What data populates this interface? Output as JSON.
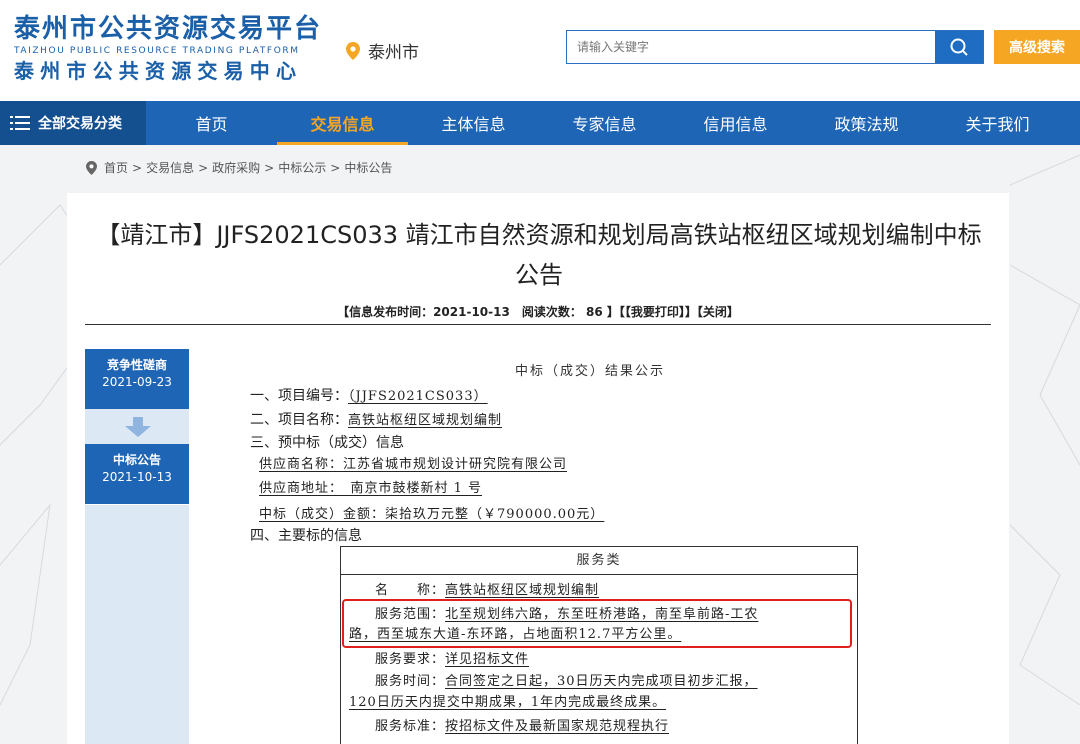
{
  "header": {
    "logo_title": "泰州市公共资源交易平台",
    "logo_en": "TAIZHOU PUBLIC RESOURCE TRADING PLATFORM",
    "logo_sub": "泰州市公共资源交易中心",
    "city": "泰州市",
    "search_placeholder": "请输入关键字",
    "advanced_search": "高级搜索"
  },
  "nav": {
    "all_categories": "全部交易分类",
    "items": [
      "首页",
      "交易信息",
      "主体信息",
      "专家信息",
      "信用信息",
      "政策法规",
      "关于我们"
    ],
    "active": "交易信息"
  },
  "breadcrumb": [
    "首页",
    "交易信息",
    "政府采购",
    "中标公示",
    "中标公告"
  ],
  "article": {
    "title": "【靖江市】JJFS2021CS033 靖江市自然资源和规划局高铁站枢纽区域规划编制中标公告",
    "meta": "【信息发布时间：2021-10-13　阅读次数： 86 】【【我要打印】】【关闭】"
  },
  "timeline": [
    {
      "name": "竞争性磋商",
      "date": "2021-09-23"
    },
    {
      "name": "中标公告",
      "date": "2021-10-13"
    }
  ],
  "document": {
    "heading": "中标（成交）结果公示",
    "s1_label": "一、项目编号：",
    "s1_value": "（JJFS2021CS033）",
    "s2_label": "二、项目名称：",
    "s2_value": "高铁站枢纽区域规划编制",
    "s3_label": "三、预中标（成交）信息",
    "supplier_name": "供应商名称：江苏省城市规划设计研究院有限公司",
    "supplier_addr": "供应商地址：　南京市鼓楼新村 1 号",
    "bid_amount": "中标（成交）金额：柒拾玖万元整（￥790000.00元）",
    "s4_label": "四、主要标的信息",
    "table": {
      "head": "服务类",
      "name_label": "名　　称：",
      "name_value": "高铁站枢纽区域规划编制",
      "scope_label": "服务范围：",
      "scope_value_1": "北至规划纬六路，东至旺桥港路，南至阜前路-工农",
      "scope_value_2": "路，西至城东大道-东环路，占地面积12.7平方公里。",
      "req_label": "服务要求：",
      "req_value": "详见招标文件",
      "time_label": "服务时间：",
      "time_value_1": "合同签定之日起，30日历天内完成项目初步汇报，",
      "time_value_2": "120日历天内提交中期成果，1年内完成最终成果。",
      "std_label": "服务标准：",
      "std_value": "按招标文件及最新国家规范规程执行"
    }
  },
  "colors": {
    "brand_blue": "#1f65b6",
    "nav_dark": "#14508f",
    "accent_orange": "#f5a623",
    "highlight_red": "#e0201a"
  }
}
